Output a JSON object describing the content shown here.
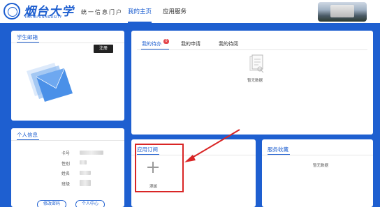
{
  "header": {
    "logo_name": "烟台大学",
    "logo_sub": "YANTAI UNIVERSITY",
    "portal_title": "统一信息门户",
    "nav": [
      {
        "label": "我的主页",
        "active": true
      },
      {
        "label": "应用服务",
        "active": false
      }
    ]
  },
  "mail": {
    "title": "学生邮箱",
    "register_label": "注册"
  },
  "info": {
    "title": "个人信息",
    "fields": [
      {
        "label": "卡号"
      },
      {
        "label": "性别"
      },
      {
        "label": "姓名"
      },
      {
        "label": "班级"
      }
    ],
    "change_password": "修改密码",
    "personal_center": "个人中心"
  },
  "tasks": {
    "tabs": [
      {
        "label": "我的待办",
        "active": true,
        "badge": "0"
      },
      {
        "label": "我的申请",
        "active": false
      },
      {
        "label": "我的待阅",
        "active": false
      }
    ],
    "empty": "暂无数据"
  },
  "subscription": {
    "title": "应用订阅",
    "add_label": "添加"
  },
  "services": {
    "title": "服务收藏",
    "empty": "暂无数据"
  },
  "colors": {
    "brand": "#1e5fd0",
    "highlight": "#d92525",
    "badge": "#e4474c"
  }
}
